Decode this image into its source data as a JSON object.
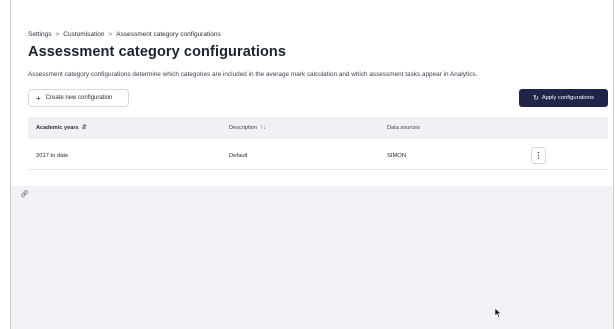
{
  "breadcrumb": {
    "items": [
      "Settings",
      "Customisation",
      "Assessment category configurations"
    ],
    "separator": ">"
  },
  "page": {
    "title": "Assessment category configurations",
    "description": "Assessment category configurations determine which categories are included in the average mark calculation and which assessment tasks appear in Analytics."
  },
  "toolbar": {
    "create_label": "Create new configuration",
    "create_icon": "plus-icon",
    "apply_label": "Apply configurations",
    "apply_icon": "refresh-icon",
    "apply_color": "#1f2448"
  },
  "table": {
    "columns": [
      {
        "label": "Academic years",
        "sort_icon": "sort-desc-icon"
      },
      {
        "label": "Description",
        "sort_icon": "sort-icon"
      },
      {
        "label": "Data sources"
      }
    ],
    "rows": [
      {
        "years": "2017 to date",
        "description": "Default",
        "sources": "SIMON",
        "menu_icon": "kebab-icon"
      }
    ]
  },
  "icons": {
    "link": "link-icon",
    "cursor": "pointer-cursor-icon"
  }
}
